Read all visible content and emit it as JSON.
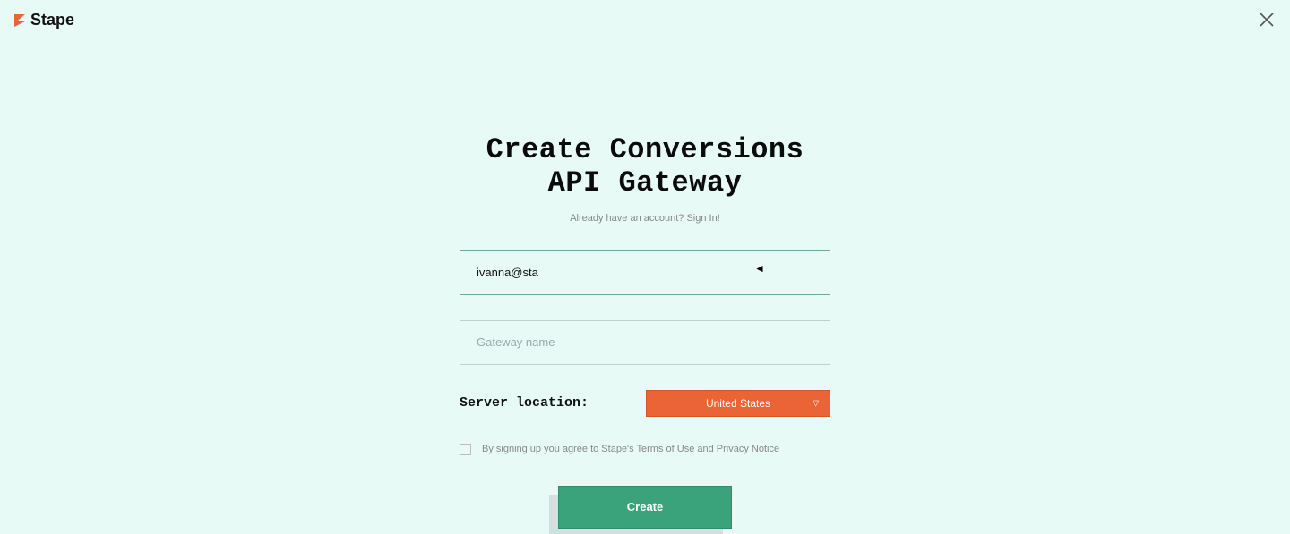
{
  "brand": "Stape",
  "title_line1": "Create Conversions",
  "title_line2": "API Gateway",
  "subtext_prefix": "Already have an account? ",
  "subtext_link": "Sign In!",
  "email_value": "ivanna@sta",
  "gateway_placeholder": "Gateway name",
  "server_label": "Server location:",
  "server_value": "United States",
  "terms_text": "By signing up you agree to Stape's Terms of Use and Privacy Notice",
  "create_label": "Create"
}
